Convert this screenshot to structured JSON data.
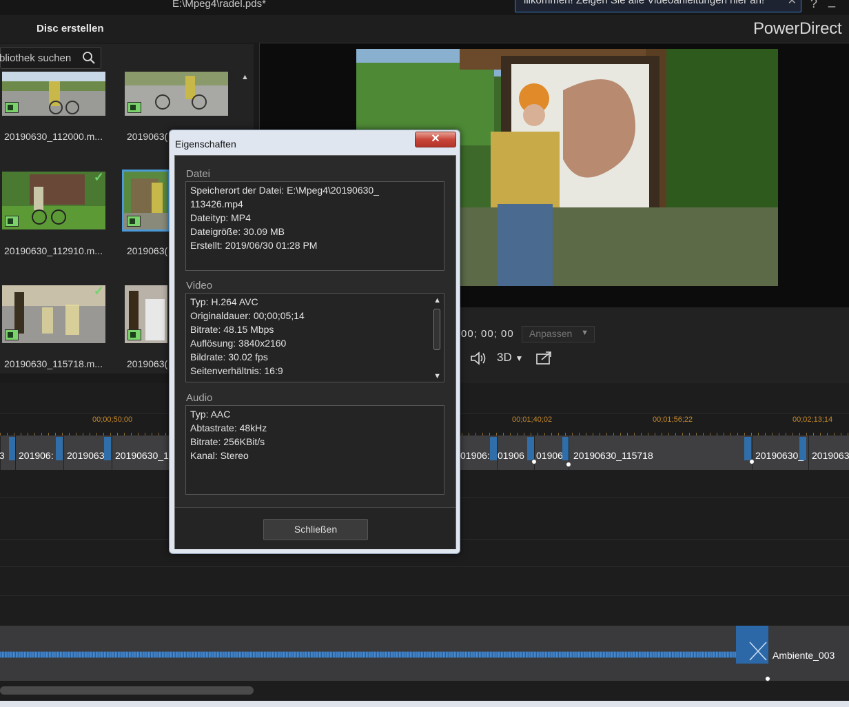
{
  "window": {
    "title": "E:\\Mpeg4\\radel.pds*",
    "help": "?",
    "minimize": "_"
  },
  "welcome": {
    "text": "illkommen! Zeigen Sie alle Videoanleitungen hier an!",
    "close": "✕"
  },
  "toolbar": {
    "disc_tab": "Disc erstellen",
    "brand": "PowerDirect"
  },
  "library": {
    "search_placeholder": "bliothek suchen",
    "items": [
      {
        "caption": "20190630_112000.m..."
      },
      {
        "caption": "2019063("
      },
      {
        "caption": "20190630_112910.m..."
      },
      {
        "caption": "2019063("
      },
      {
        "caption": "20190630_115718.m..."
      },
      {
        "caption": "2019063("
      }
    ]
  },
  "player": {
    "timecode": "00; 00; 00",
    "fit": "Anpassen",
    "three_d": "3D"
  },
  "timeline": {
    "ruler": [
      "00;00;50;00",
      "00;01;40;02",
      "00;01;56;22",
      "00;02;13;14"
    ],
    "clips": [
      "63",
      "201906:",
      "2019063",
      "20190630_1",
      "01906:",
      "01906",
      "01906",
      "20190630_115718",
      "20190630_",
      "2019063"
    ],
    "audio_clip": "Ambiente_003"
  },
  "dialog": {
    "title": "Eigenschaften",
    "close_x": "✕",
    "file": {
      "title": "Datei",
      "lines": [
        "Speicherort der Datei: E:\\Mpeg4\\20190630_",
        "113426.mp4",
        "Dateityp: MP4",
        "Dateigröße: 30.09 MB",
        "Erstellt: 2019/06/30 01:28 PM"
      ]
    },
    "video": {
      "title": "Video",
      "lines": [
        "Typ: H.264 AVC",
        "Originaldauer: 00;00;05;14",
        "Bitrate: 48.15 Mbps",
        "Auflösung: 3840x2160",
        "Bildrate: 30.02 fps",
        "Seitenverhältnis: 16:9"
      ]
    },
    "audio": {
      "title": "Audio",
      "lines": [
        "Typ: AAC",
        "Abtastrate: 48kHz",
        "Bitrate: 256KBit/s",
        "Kanal: Stereo"
      ]
    },
    "close_button": "Schließen"
  }
}
